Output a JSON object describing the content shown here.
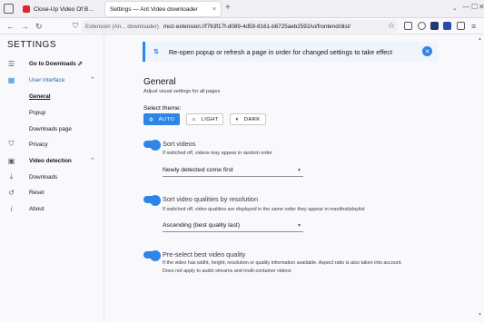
{
  "browser": {
    "tabs": [
      {
        "title": "Close-Up Video Of Butterfly On",
        "active": false
      },
      {
        "title": "Settings — Ant Video downloader",
        "active": true
      }
    ],
    "close_glyph": "×",
    "new_tab_glyph": "+",
    "tabs_list_glyph": "⌄",
    "window_controls": [
      "—",
      "☐",
      "✕"
    ],
    "nav": {
      "back": "←",
      "forward": "→",
      "reload": "↻"
    },
    "url": {
      "extension_label": "Extension (An... downloader)",
      "address": "moz-extension://f763f17f-d089-4d59-8161-b6725aeb2592/ui/frontend/dist/"
    },
    "star_glyph": "☆"
  },
  "sidebar": {
    "title": "SETTINGS",
    "items": [
      {
        "label": "Go to Downloads ⬀",
        "icon": "download-page-icon",
        "glyph": "☰"
      },
      {
        "label": "User interface",
        "icon": "grid-icon",
        "glyph": "▦",
        "chevron": "⌃"
      },
      {
        "label": "General"
      },
      {
        "label": "Popup"
      },
      {
        "label": "Downloads page"
      },
      {
        "label": "Privacy",
        "icon": "shield-icon",
        "glyph": "⛉"
      },
      {
        "label": "Video detection",
        "icon": "video-icon",
        "glyph": "▣",
        "chevron": "⌃"
      },
      {
        "label": "Downloads",
        "icon": "download-icon",
        "glyph": "⤓"
      },
      {
        "label": "Reset",
        "icon": "reset-icon",
        "glyph": "↺"
      },
      {
        "label": "About",
        "icon": "info-icon",
        "glyph": "i"
      }
    ]
  },
  "notice": {
    "icon_glyph": "⇅",
    "text": "Re-open popup or refresh a page in order for changed settings to take effect",
    "close_glyph": "✕"
  },
  "general": {
    "title": "General",
    "subtitle": "Adjust visual settings for all pages",
    "theme_label": "Select theme:",
    "themes": [
      {
        "label": "AUTO",
        "glyph": "✲",
        "selected": true
      },
      {
        "label": "LIGHT",
        "glyph": "☼",
        "selected": false
      },
      {
        "label": "DARK",
        "glyph": "◐",
        "selected": false
      }
    ],
    "options": [
      {
        "title": "Sort videos",
        "desc": "If switched off, videos may appear in random order",
        "enabled": true,
        "select": "Newly detected come first"
      },
      {
        "title": "Sort video qualities by resolution",
        "desc": "If switched off, video qualities are displayed in the same order they appear in manifest/playlist",
        "enabled": true,
        "select": "Ascending (best quality last)"
      },
      {
        "title": "Pre-select best video quality",
        "desc": "If the video has widht, height, resolution or quality information available. Aspect ratio is also taken into account.",
        "desc2": "Does not apply to audio streams and multi-container videos",
        "enabled": true
      }
    ],
    "select_arrow": "▼"
  },
  "colors": {
    "accent": "#2d86e5",
    "active_nav": "#2b5eb0",
    "brand_red": "#e0262f"
  }
}
